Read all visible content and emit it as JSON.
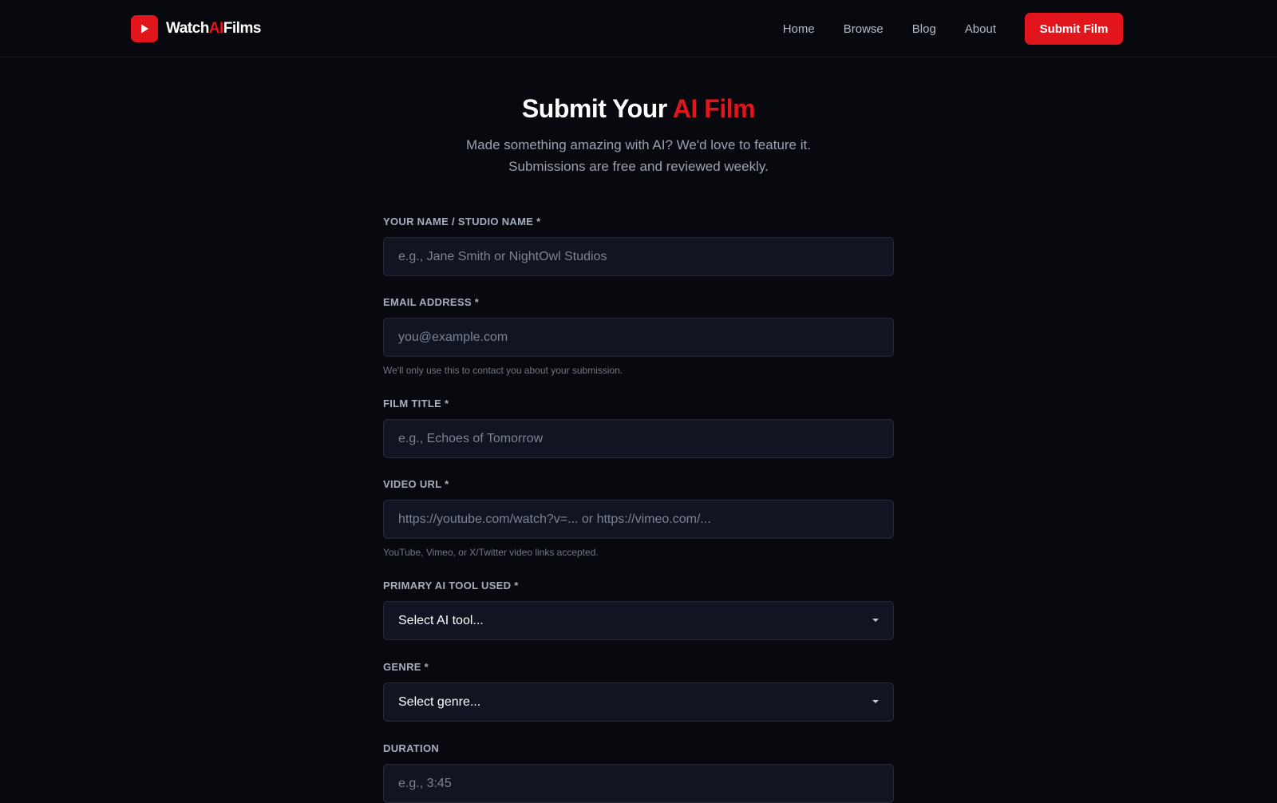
{
  "nav": {
    "logo_prefix": "Watch",
    "logo_accent": "AI",
    "logo_suffix": "Films",
    "links": [
      "Home",
      "Browse",
      "Blog",
      "About"
    ],
    "cta": "Submit Film"
  },
  "hero": {
    "title_main": "Submit Your ",
    "title_accent": "AI Film",
    "subtitle_line1": "Made something amazing with AI? We'd love to feature it.",
    "subtitle_line2": "Submissions are free and reviewed weekly."
  },
  "form": {
    "name": {
      "label": "YOUR NAME / STUDIO NAME *",
      "placeholder": "e.g., Jane Smith or NightOwl Studios",
      "value": ""
    },
    "email": {
      "label": "EMAIL ADDRESS *",
      "placeholder": "you@example.com",
      "value": "",
      "help": "We'll only use this to contact you about your submission."
    },
    "title": {
      "label": "FILM TITLE *",
      "placeholder": "e.g., Echoes of Tomorrow",
      "value": ""
    },
    "video_url": {
      "label": "VIDEO URL *",
      "placeholder": "https://youtube.com/watch?v=... or https://vimeo.com/...",
      "value": "",
      "help": "YouTube, Vimeo, or X/Twitter video links accepted."
    },
    "ai_tool": {
      "label": "PRIMARY AI TOOL USED *",
      "selected": "Select AI tool..."
    },
    "genre": {
      "label": "GENRE *",
      "selected": "Select genre..."
    },
    "duration": {
      "label": "DURATION",
      "placeholder": "e.g., 3:45",
      "value": ""
    }
  },
  "colors": {
    "background": "#07090e",
    "accent": "#e3151c",
    "field_bg": "#111522",
    "field_border": "#252b3b",
    "label": "#a7aebf",
    "muted": "#6f7685"
  },
  "icons": {
    "logo": "play-icon",
    "select_caret": "chevron-down-icon"
  }
}
